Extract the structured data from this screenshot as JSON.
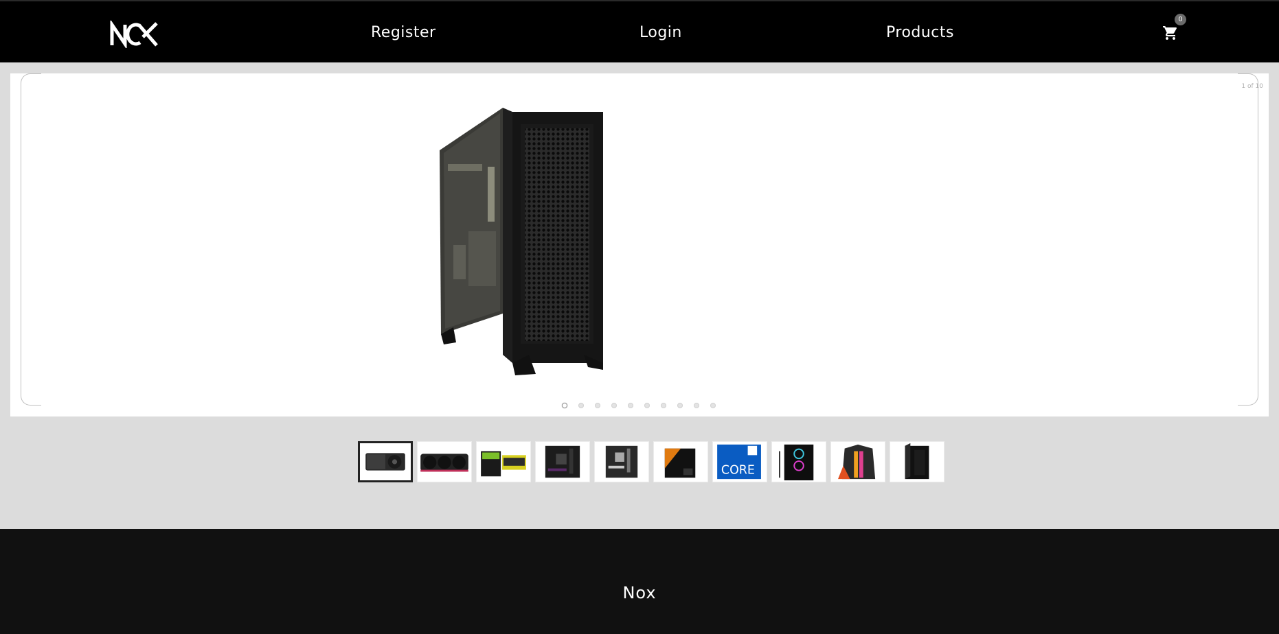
{
  "header": {
    "logo_alt": "NOX",
    "nav": {
      "register": "Register",
      "login": "Login",
      "products": "Products"
    },
    "cart_count": "0",
    "cart_icon": "cart-icon"
  },
  "carousel": {
    "status": "1 of 10",
    "slide_count": 10,
    "active_index": 0,
    "main_image": "pc-case-black-mesh"
  },
  "thumbnails": [
    {
      "name": "gpu-founders-edition"
    },
    {
      "name": "gpu-triple-fan-rgb"
    },
    {
      "name": "gpu-boxed-green"
    },
    {
      "name": "motherboard-black"
    },
    {
      "name": "motherboard-gray"
    },
    {
      "name": "cpu-box-orange"
    },
    {
      "name": "cpu-box-intel-core-i9"
    },
    {
      "name": "pc-case-rgb-fans"
    },
    {
      "name": "pc-case-orange-rgb"
    },
    {
      "name": "pc-case-black"
    }
  ],
  "footer": {
    "brand": "Nox"
  },
  "colors": {
    "header_bg": "#000000",
    "page_bg": "#dcdcdc",
    "footer_bg": "#111111"
  }
}
